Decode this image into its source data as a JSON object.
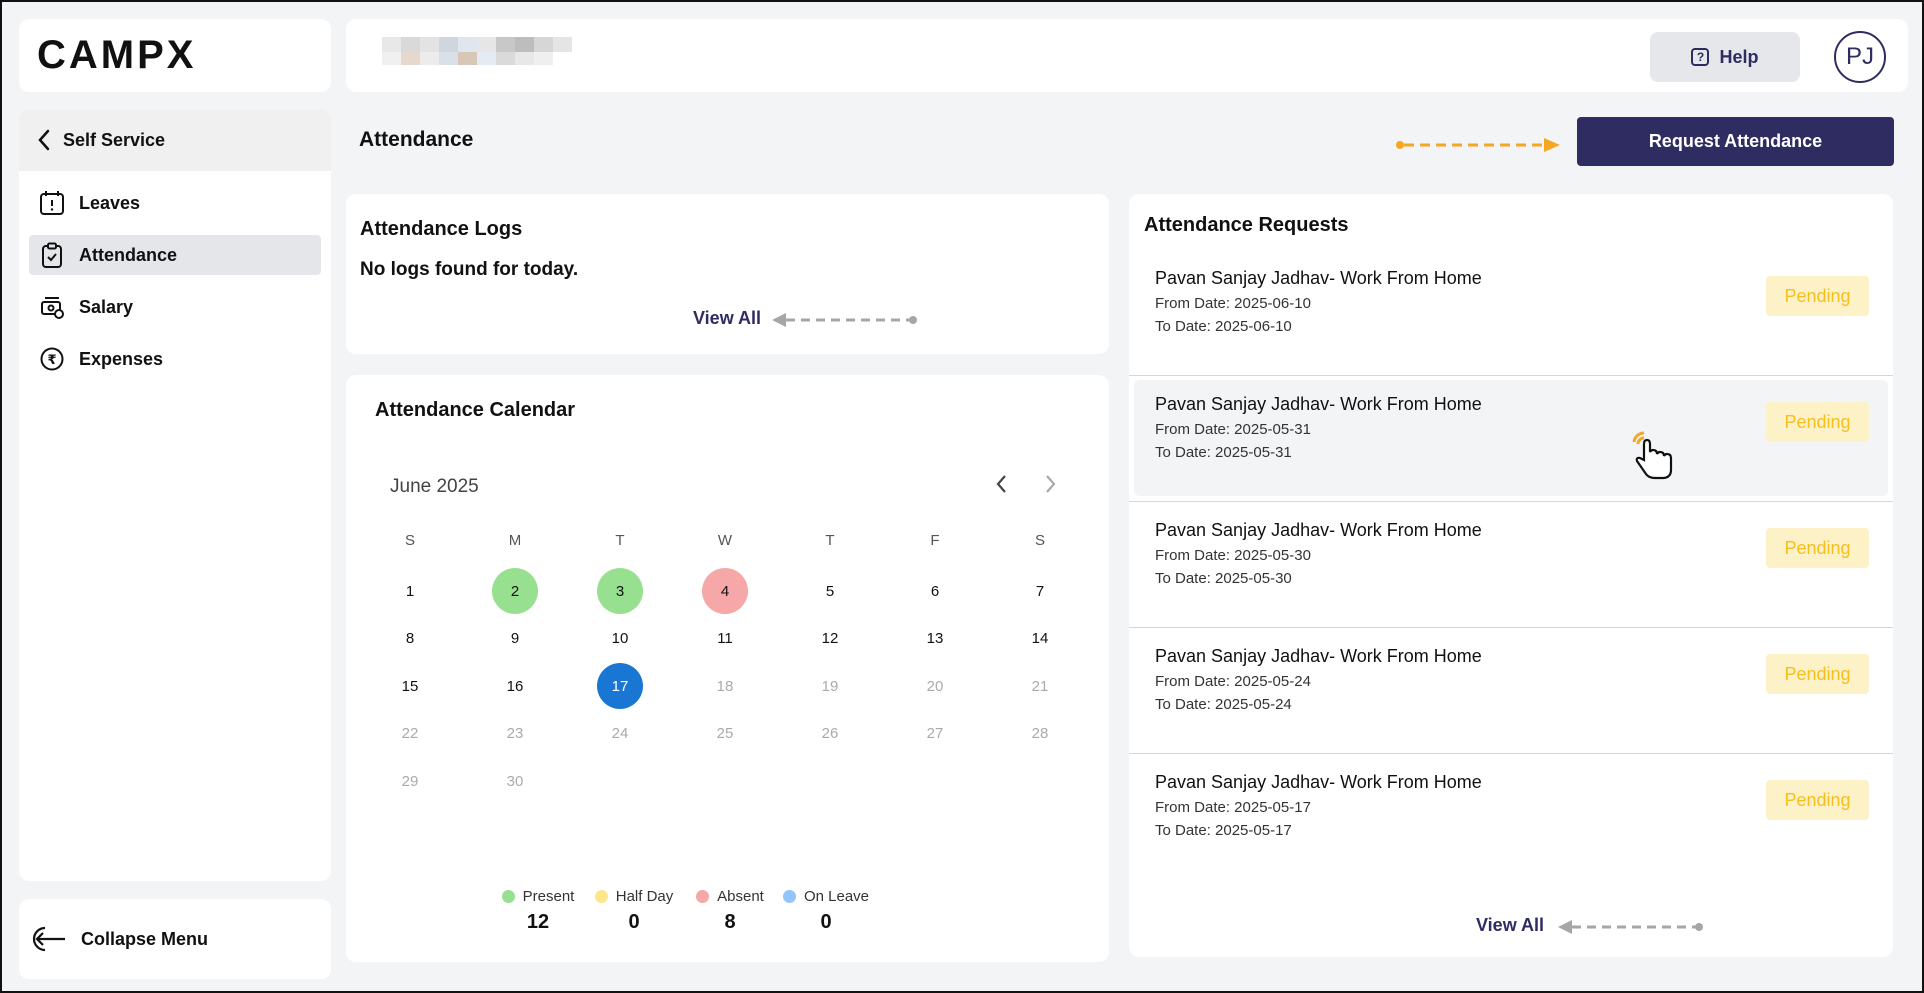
{
  "brand": {
    "logo": "CAMPX"
  },
  "header": {
    "help_label": "Help",
    "avatar_initials": "PJ"
  },
  "sidebar": {
    "back_label": "Self Service",
    "items": [
      {
        "label": "Leaves",
        "icon": "calendar-alert-icon"
      },
      {
        "label": "Attendance",
        "icon": "clipboard-check-icon"
      },
      {
        "label": "Salary",
        "icon": "money-icon"
      },
      {
        "label": "Expenses",
        "icon": "rupee-icon"
      }
    ],
    "collapse_label": "Collapse Menu"
  },
  "page": {
    "title": "Attendance",
    "request_button": "Request Attendance"
  },
  "logs": {
    "title": "Attendance Logs",
    "empty_text": "No logs found for today.",
    "view_all": "View All"
  },
  "calendar": {
    "title": "Attendance Calendar",
    "month": "June 2025",
    "weekdays": [
      "S",
      "M",
      "T",
      "W",
      "T",
      "F",
      "S"
    ],
    "days": [
      "1",
      "2",
      "3",
      "4",
      "5",
      "6",
      "7",
      "8",
      "9",
      "10",
      "11",
      "12",
      "13",
      "14",
      "15",
      "16",
      "17",
      "18",
      "19",
      "20",
      "21",
      "22",
      "23",
      "24",
      "25",
      "26",
      "27",
      "28",
      "29",
      "30"
    ],
    "day_status": {
      "2": "present",
      "3": "present",
      "4": "absent",
      "17": "today"
    },
    "today": 17,
    "legend": [
      {
        "label": "Present",
        "count": "12",
        "color": "#97e08f"
      },
      {
        "label": "Half Day",
        "count": "0",
        "color": "#fde68a"
      },
      {
        "label": "Absent",
        "count": "8",
        "color": "#f6a7a7"
      },
      {
        "label": "On Leave",
        "count": "0",
        "color": "#93c5fd"
      }
    ]
  },
  "requests": {
    "title": "Attendance Requests",
    "view_all": "View All",
    "items": [
      {
        "name": "Pavan Sanjay Jadhav- Work From Home",
        "from": "From Date: 2025-06-10",
        "to": "To Date: 2025-06-10",
        "status": "Pending"
      },
      {
        "name": "Pavan Sanjay Jadhav- Work From Home",
        "from": "From Date: 2025-05-31",
        "to": "To Date: 2025-05-31",
        "status": "Pending"
      },
      {
        "name": "Pavan Sanjay Jadhav- Work From Home",
        "from": "From Date: 2025-05-30",
        "to": "To Date: 2025-05-30",
        "status": "Pending"
      },
      {
        "name": "Pavan Sanjay Jadhav- Work From Home",
        "from": "From Date: 2025-05-24",
        "to": "To Date: 2025-05-24",
        "status": "Pending"
      },
      {
        "name": "Pavan Sanjay Jadhav- Work From Home",
        "from": "From Date: 2025-05-17",
        "to": "To Date: 2025-05-17",
        "status": "Pending"
      }
    ]
  },
  "colors": {
    "primary": "#2f2c62",
    "pending_bg": "#fdf1c8",
    "pending_text": "#f5bf1e",
    "today": "#1976d2",
    "annotation_arrow": "#f5a623"
  }
}
